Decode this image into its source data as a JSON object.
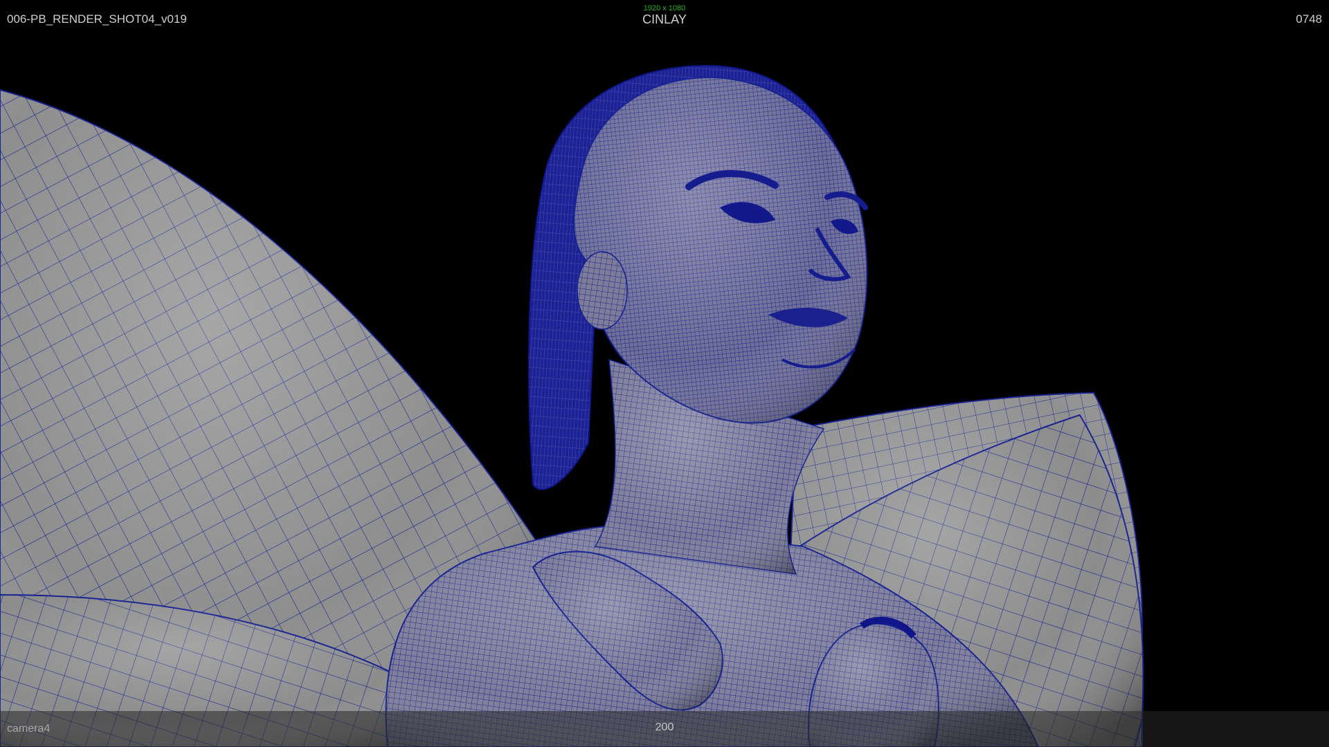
{
  "hud": {
    "shot_name": "006-PB_RENDER_SHOT04_v019",
    "title": "CINLAY",
    "resolution": "1920 x 1080",
    "frame": "0748",
    "camera": "camera4",
    "focal_length": "200"
  },
  "colors": {
    "background": "#000000",
    "mesh_fill": "#8a8a8a",
    "wireframe": "#101a8c",
    "resolution_text": "#22b422",
    "hud_text": "#d0d0d0"
  }
}
